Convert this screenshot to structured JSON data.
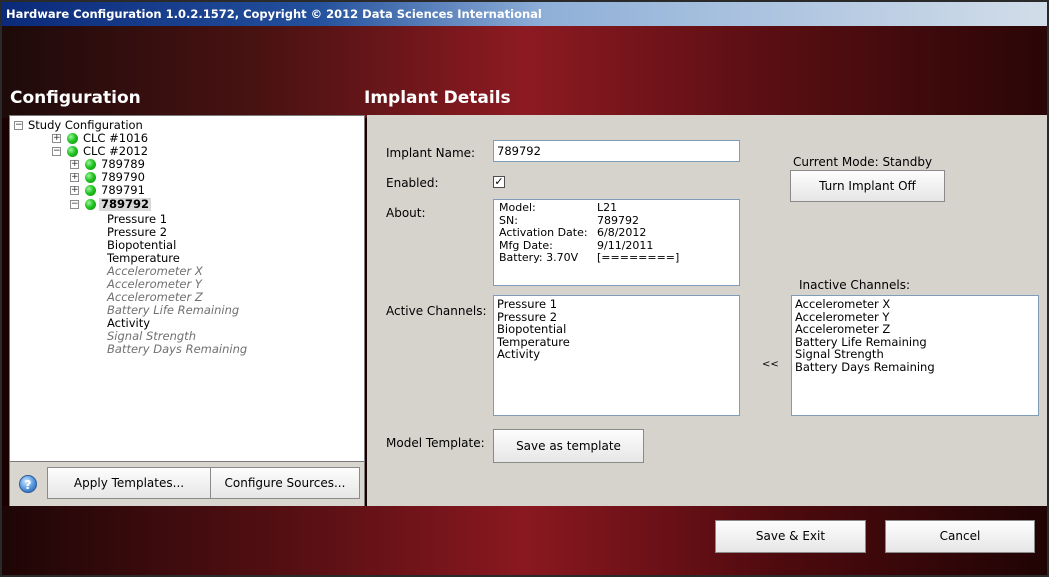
{
  "window": {
    "title": "Hardware Configuration 1.0.2.1572, Copyright © 2012 Data Sciences International"
  },
  "configuration": {
    "title": "Configuration",
    "tree": {
      "root": "Study Configuration",
      "clc1": "CLC #1016",
      "clc2": "CLC #2012",
      "implants": [
        "789789",
        "789790",
        "789791",
        "789792"
      ],
      "selected_implant": "789792",
      "channels": [
        {
          "label": "Pressure 1",
          "active": true
        },
        {
          "label": "Pressure 2",
          "active": true
        },
        {
          "label": "Biopotential",
          "active": true
        },
        {
          "label": "Temperature",
          "active": true
        },
        {
          "label": "Accelerometer X",
          "active": false
        },
        {
          "label": "Accelerometer Y",
          "active": false
        },
        {
          "label": "Accelerometer Z",
          "active": false
        },
        {
          "label": "Battery Life Remaining",
          "active": false
        },
        {
          "label": "Activity",
          "active": true
        },
        {
          "label": "Signal Strength",
          "active": false
        },
        {
          "label": "Battery Days Remaining",
          "active": false
        }
      ]
    },
    "apply_templates_label": "Apply Templates...",
    "configure_sources_label": "Configure Sources..."
  },
  "implant_details": {
    "title": "Implant Details",
    "name_label": "Implant Name:",
    "name_value": "789792",
    "enabled_label": "Enabled:",
    "enabled_checked": true,
    "about_label": "About:",
    "about": {
      "model_key": "Model:",
      "model_val": "L21",
      "sn_key": "SN:",
      "sn_val": "789792",
      "activation_key": "Activation Date:",
      "activation_val": "6/8/2012",
      "mfg_key": "Mfg Date:",
      "mfg_val": "9/11/2011",
      "battery_key": "Battery: 3.70V",
      "battery_val": "[========]"
    },
    "current_mode": "Current Mode: Standby",
    "turn_off_label": "Turn Implant Off",
    "active_channels_label": "Active Channels:",
    "active_channels": [
      "Pressure 1",
      "Pressure 2",
      "Biopotential",
      "Temperature",
      "Activity"
    ],
    "inactive_channels_label": "Inactive Channels:",
    "inactive_channels": [
      "Accelerometer X",
      "Accelerometer Y",
      "Accelerometer Z",
      "Battery Life Remaining",
      "Signal Strength",
      "Battery Days Remaining"
    ],
    "move_left_label": "<<",
    "model_template_label": "Model Template:",
    "save_template_label": "Save as template"
  },
  "footer": {
    "save_exit_label": "Save & Exit",
    "cancel_label": "Cancel"
  },
  "icons": {
    "help": "help-icon",
    "status_dot": "green-status-icon",
    "expand": "expand-icon",
    "collapse": "collapse-icon"
  },
  "colors": {
    "title_bar": "#0b2a7a",
    "band_red": "#8d1a22",
    "panel_bg": "#d6d3cc",
    "status_green": "#22c422",
    "inactive_text": "#707070"
  }
}
